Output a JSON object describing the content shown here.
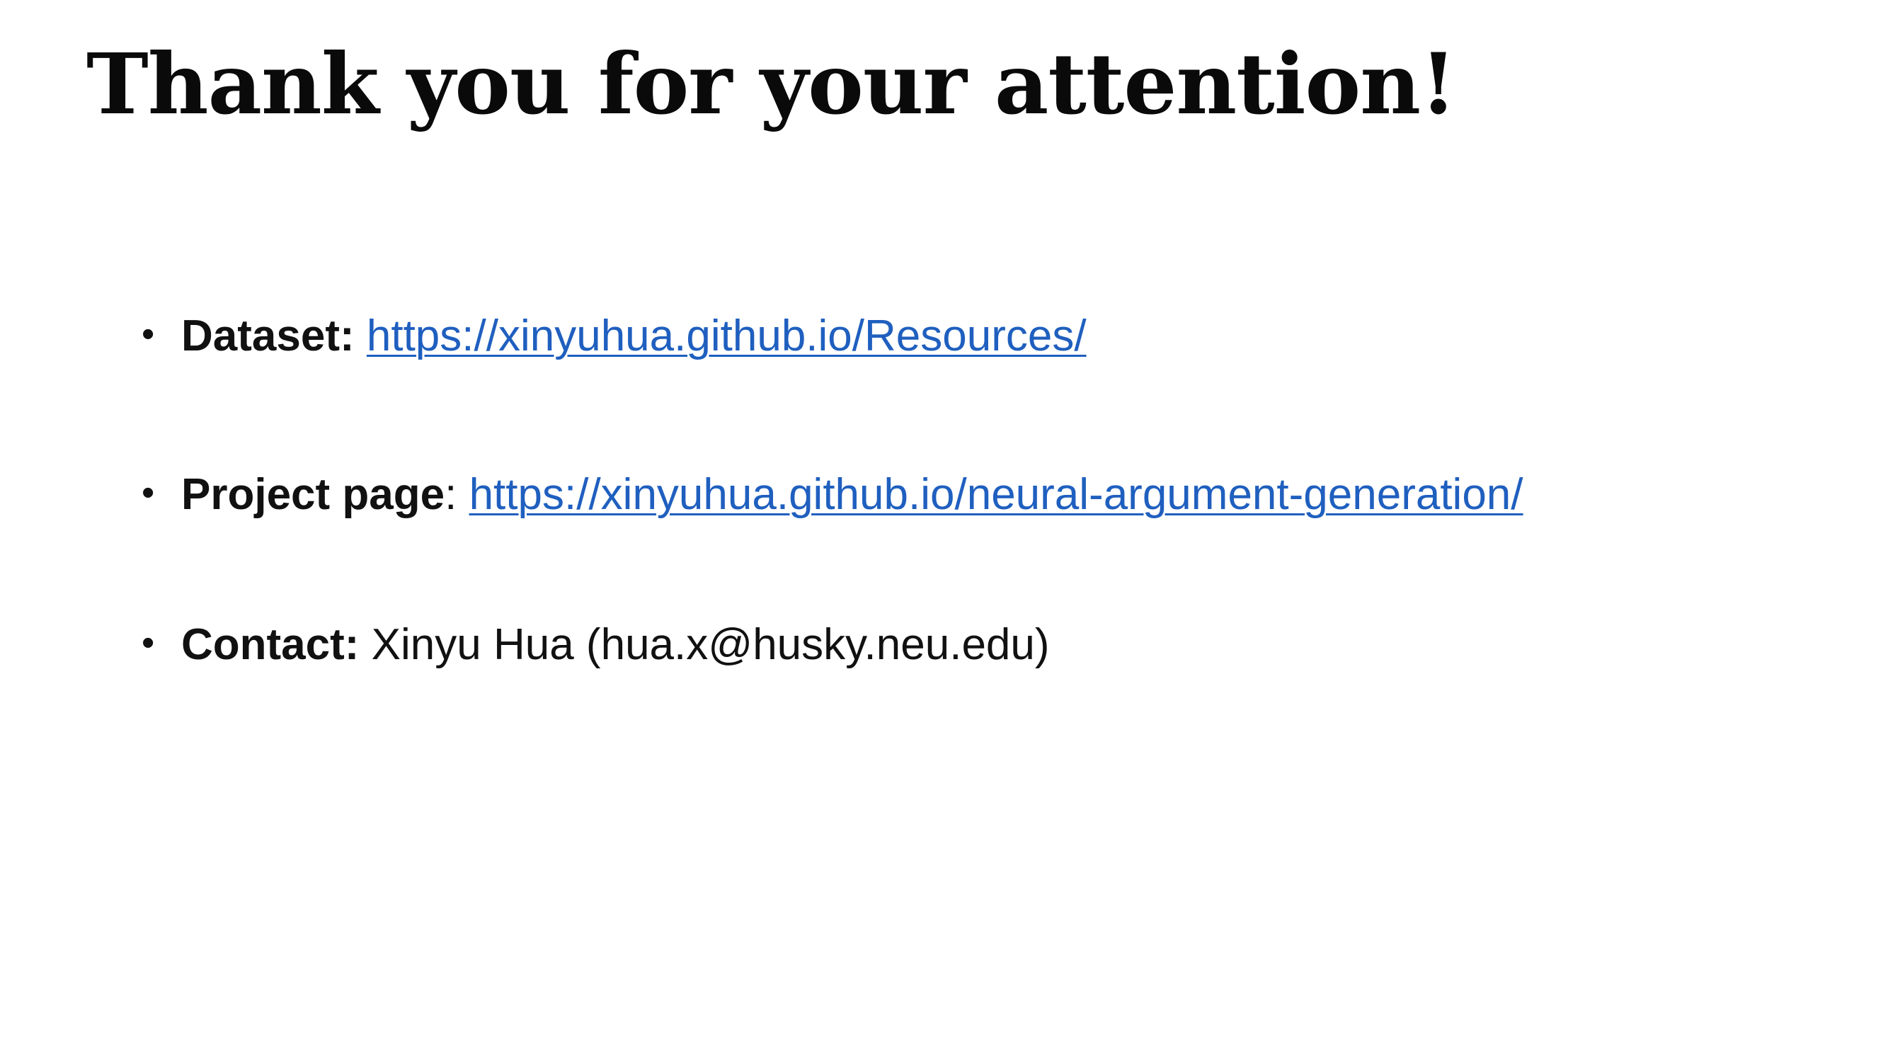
{
  "slide": {
    "title": "Thank you for your attention!",
    "bullet_glyph": "•",
    "items": [
      {
        "label": "Dataset:",
        "separator": " ",
        "link": "https://xinyuhua.github.io/Resources/"
      },
      {
        "label": "Project page",
        "separator": ": ",
        "link": "https://xinyuhua.github.io/neural-argument-generation/"
      },
      {
        "label": "Contact:",
        "separator": " ",
        "text": "Xinyu Hua (hua.x@husky.neu.edu)"
      }
    ]
  },
  "colors": {
    "link": "#1f5fbf",
    "text": "#111111",
    "background": "#ffffff"
  }
}
